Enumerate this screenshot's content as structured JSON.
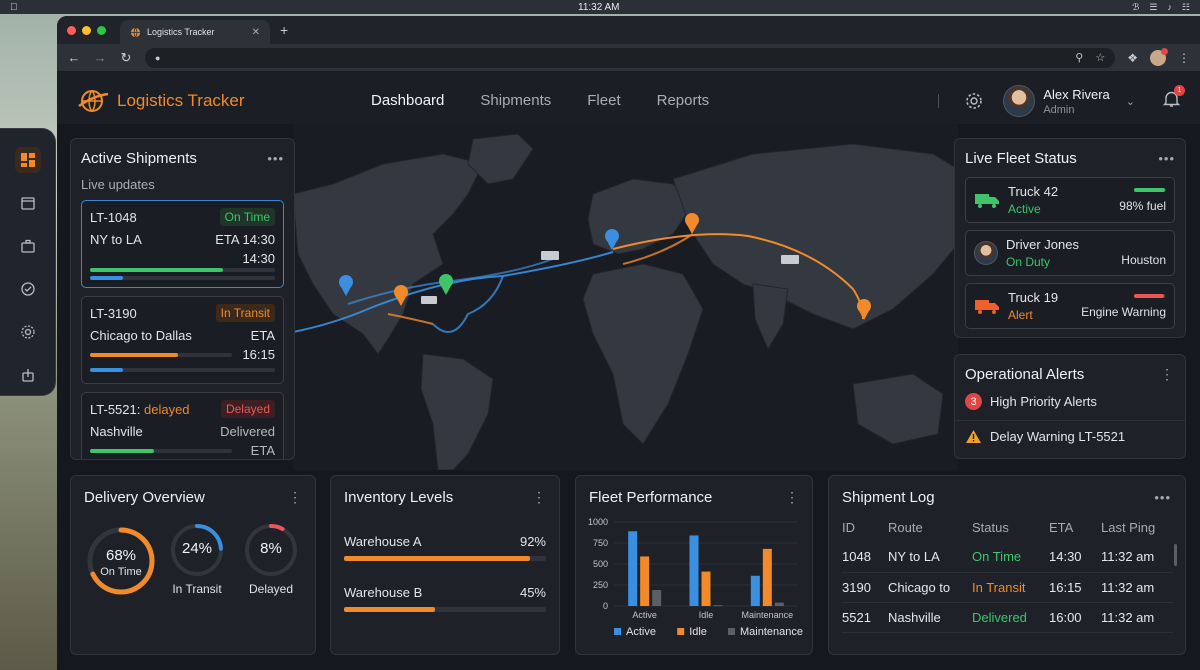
{
  "os": {
    "time": "11:32 AM"
  },
  "browser": {
    "tab_title": "Logistics Tracker"
  },
  "app": {
    "name": "Logistics Tracker"
  },
  "nav": {
    "tabs": [
      "Dashboard",
      "Shipments",
      "Fleet",
      "Reports"
    ],
    "active": "Dashboard"
  },
  "user": {
    "name": "Alex Rivera",
    "role": "Admin",
    "notifications": "1"
  },
  "active_shipments": {
    "title": "Active Shipments",
    "subtitle": "Live updates",
    "items": [
      {
        "id": "LT-1048",
        "status": "On Time",
        "route": "NY to LA",
        "eta": "ETA 14:30",
        "eta_time": "14:30",
        "progress": 0.72
      },
      {
        "id": "LT-3190",
        "status": "In Transit",
        "route": "Chicago to Dallas",
        "eta": "ETA",
        "eta_time": "16:15",
        "progress": 0.62
      },
      {
        "id": "LT-5521:",
        "id_suffix": "delayed",
        "status": "Delayed",
        "route": "Nashville",
        "eta": "Delivered",
        "eta_time": "ETA",
        "progress": 0.45
      }
    ]
  },
  "fleet_status": {
    "title": "Live Fleet Status",
    "items": [
      {
        "name": "Truck 42",
        "state": "Active",
        "detail": "98% fuel",
        "level": 0.98,
        "color": "#3fc46b"
      },
      {
        "name": "Driver Jones",
        "state": "On Duty",
        "detail": "Houston"
      },
      {
        "name": "Truck 19",
        "state": "Alert",
        "detail": "Engine Warning",
        "level": 0.95,
        "color": "#ec5656"
      }
    ]
  },
  "alerts": {
    "title": "Operational Alerts",
    "count": "3",
    "high": "High Priority Alerts",
    "warning": "Delay Warning LT-5521"
  },
  "delivery": {
    "title": "Delivery Overview",
    "rings": [
      {
        "value": "68%",
        "label": "On Time",
        "pct": 0.68,
        "color": "#f08a2a"
      },
      {
        "value": "24%",
        "label": "In Transit",
        "pct": 0.24,
        "color": "#3b8fe0"
      },
      {
        "value": "8%",
        "label": "Delayed",
        "pct": 0.08,
        "color": "#ec5656"
      }
    ]
  },
  "inventory": {
    "title": "Inventory Levels",
    "items": [
      {
        "name": "Warehouse A",
        "value": "92%",
        "pct": 0.92
      },
      {
        "name": "Warehouse B",
        "value": "45%",
        "pct": 0.45
      }
    ]
  },
  "chart_data": {
    "type": "bar",
    "title": "Fleet Performance",
    "categories": [
      "Active",
      "Idle",
      "Maintenance"
    ],
    "series": [
      {
        "name": "Active",
        "values": [
          890,
          840,
          360
        ],
        "color": "#3b8fe0"
      },
      {
        "name": "Idle",
        "values": [
          590,
          410,
          680
        ],
        "color": "#f08a2a"
      },
      {
        "name": "Maintenance",
        "values": [
          190,
          10,
          40
        ],
        "color": "#5b6068"
      }
    ],
    "yticks": [
      "1000",
      "750",
      "500",
      "250",
      "0"
    ],
    "ylim": [
      0,
      1000
    ],
    "legend": "bottom"
  },
  "shipment_log": {
    "title": "Shipment Log",
    "columns": [
      "ID",
      "Route",
      "Status",
      "ETA",
      "Last Ping"
    ],
    "rows": [
      {
        "id": "1048",
        "route": "NY to LA",
        "status": "On Time",
        "eta": "14:30",
        "ping": "11:32 am",
        "color": "#3fc46b"
      },
      {
        "id": "3190",
        "route": "Chicago to",
        "status": "In Transit",
        "eta": "16:15",
        "ping": "11:32 am",
        "color": "#f08a2a"
      },
      {
        "id": "5521",
        "route": "Nashville",
        "status": "Delivered",
        "eta": "16:00",
        "ping": "11:32 am",
        "color": "#3fc46b"
      }
    ]
  },
  "colors": {
    "accent": "#f08a2a",
    "blue": "#3b8fe0",
    "green": "#3fc46b",
    "red": "#ec5656"
  }
}
